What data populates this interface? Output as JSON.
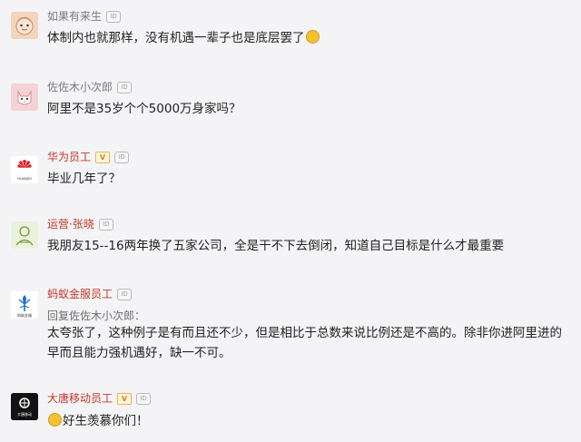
{
  "comments": [
    {
      "username": "如果有来生",
      "id_badge": "ID",
      "text": "体制内也就那样，没有机遇一辈子也是底层罢了",
      "trailing_emoji": "emoji-icon"
    },
    {
      "username": "佐佐木小次郎",
      "id_badge": "ID",
      "text": "阿里不是35岁个个5000万身家吗？"
    },
    {
      "username": "华为员工",
      "v_badge": "V",
      "id_badge": "ID",
      "text": "毕业几年了？",
      "avatar_logo": "HUAWEI"
    },
    {
      "username": "运营·张晓",
      "id_badge": "ID",
      "text": "我朋友15--16两年换了五家公司，全是干不下去倒闭，知道自己目标是什么才最重要"
    },
    {
      "username": "蚂蚁金服员工",
      "id_badge": "ID",
      "reply_to": "回复佐佐木小次郎：",
      "text_line1": "太夸张了，这种例子是有而且还不少，但是相比于总数来说比例还是不高的。除非你进阿里进的",
      "text_line2": "早而且能力强机遇好，缺一不可。",
      "avatar_logo": "蚂蚁金服"
    },
    {
      "username": "大唐移动员工",
      "v_badge": "V",
      "id_badge": "ID",
      "text": "好生羡慕你们！",
      "leading_emoji": "emoji-icon",
      "avatar_logo": "大唐移动"
    }
  ],
  "colors": {
    "background": "#f4f4f6",
    "username_gray": "#7a7a7a",
    "username_red": "#c0392b",
    "text": "#222222"
  }
}
